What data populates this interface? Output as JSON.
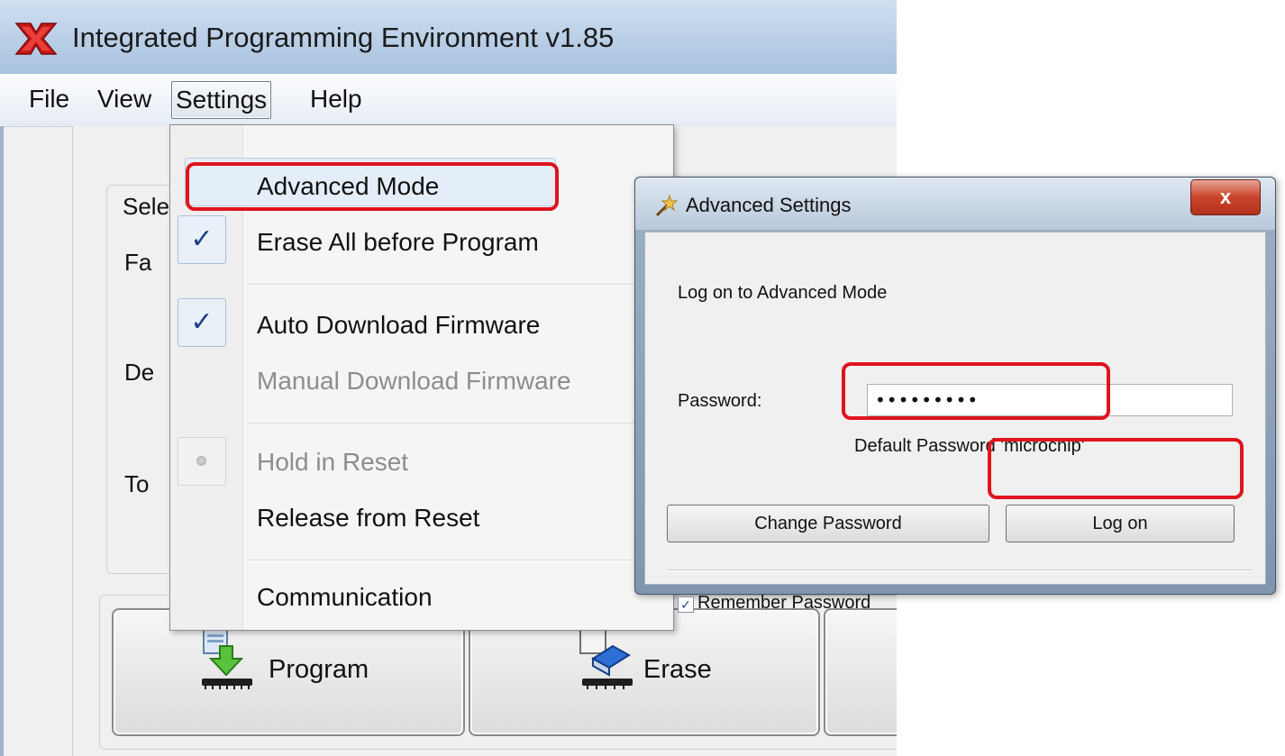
{
  "app": {
    "title": "Integrated Programming Environment v1.85"
  },
  "menu_bar": {
    "items": [
      "File",
      "View",
      "Settings",
      "Help"
    ]
  },
  "main": {
    "group_labels": [
      "Sele",
      "Fa",
      "De",
      "To"
    ],
    "buttons": [
      {
        "label": "Program",
        "icon": "program-download-icon"
      },
      {
        "label": "Erase",
        "icon": "eraser-icon"
      }
    ]
  },
  "settings_menu": {
    "items": [
      {
        "label": "Advanced Mode",
        "state": "highlighted"
      },
      {
        "label": "Erase All before Program",
        "state": "checked"
      },
      {
        "label": "Auto Download Firmware",
        "state": "checked"
      },
      {
        "label": "Manual Download Firmware",
        "state": "disabled"
      },
      {
        "label": "Hold in Reset",
        "state": "disabled-radio"
      },
      {
        "label": "Release from Reset",
        "state": "normal"
      },
      {
        "label": "Communication",
        "state": "normal"
      }
    ]
  },
  "advanced_settings": {
    "title": "Advanced Settings",
    "close_label": "x",
    "heading": "Log on to Advanced Mode",
    "password_label": "Password:",
    "password_value": "•••••••••",
    "hint": "Default Password 'microchip'",
    "change_password_label": "Change Password",
    "log_on_label": "Log on",
    "remember_label": "Remember Password",
    "remember_checked": true,
    "check_glyph": "✓"
  },
  "colors": {
    "annotation_red": "#e0141c",
    "titlebar_blue": "#b7cde6",
    "checkmark_blue": "#1f3f8c"
  }
}
